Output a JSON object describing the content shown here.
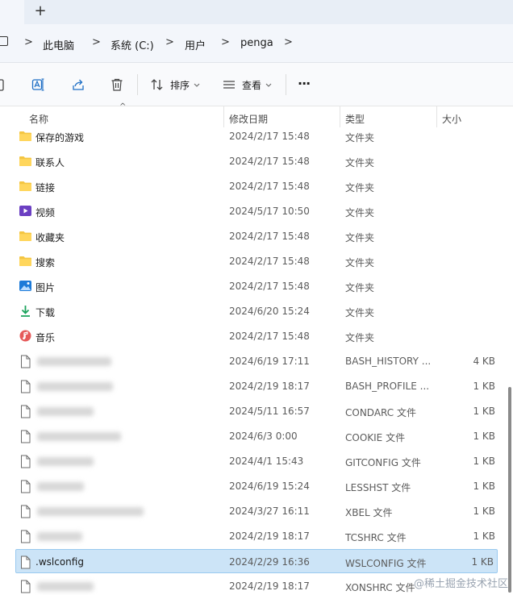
{
  "tabbar": {
    "new_tab": "+"
  },
  "breadcrumb": [
    "此电脑",
    "系统 (C:)",
    "用户",
    "penga"
  ],
  "chevron": ">",
  "commandbar": {
    "sort_label": "排序",
    "view_label": "查看",
    "more_label": "···"
  },
  "columns": {
    "name": "名称",
    "date": "修改日期",
    "type": "类型",
    "size": "大小"
  },
  "rows": [
    {
      "icon": "folder",
      "name": "保存的游戏",
      "date": "2024/2/17 15:48",
      "type": "文件夹",
      "size": ""
    },
    {
      "icon": "contacts-folder",
      "name": "联系人",
      "date": "2024/2/17 15:48",
      "type": "文件夹",
      "size": ""
    },
    {
      "icon": "folder",
      "name": "链接",
      "date": "2024/2/17 15:48",
      "type": "文件夹",
      "size": ""
    },
    {
      "icon": "video-folder",
      "name": "视频",
      "date": "2024/5/17 10:50",
      "type": "文件夹",
      "size": ""
    },
    {
      "icon": "folder",
      "name": "收藏夹",
      "date": "2024/2/17 15:48",
      "type": "文件夹",
      "size": ""
    },
    {
      "icon": "folder",
      "name": "搜索",
      "date": "2024/2/17 15:48",
      "type": "文件夹",
      "size": ""
    },
    {
      "icon": "pictures-folder",
      "name": "图片",
      "date": "2024/2/17 15:48",
      "type": "文件夹",
      "size": ""
    },
    {
      "icon": "download-folder",
      "name": "下载",
      "date": "2024/6/20 15:24",
      "type": "文件夹",
      "size": ""
    },
    {
      "icon": "music-folder",
      "name": "音乐",
      "date": "2024/2/17 15:48",
      "type": "文件夹",
      "size": ""
    },
    {
      "icon": "file",
      "name": "",
      "date": "2024/6/19 17:11",
      "type": "BASH_HISTORY ...",
      "size": "4 KB"
    },
    {
      "icon": "file",
      "name": "",
      "date": "2024/2/19 18:17",
      "type": "BASH_PROFILE ...",
      "size": "1 KB"
    },
    {
      "icon": "file",
      "name": "",
      "date": "2024/5/11 16:57",
      "type": "CONDARC 文件",
      "size": "1 KB"
    },
    {
      "icon": "file",
      "name": "",
      "date": "2024/6/3 0:00",
      "type": "COOKIE 文件",
      "size": "1 KB"
    },
    {
      "icon": "file",
      "name": "",
      "date": "2024/4/1 15:43",
      "type": "GITCONFIG 文件",
      "size": "1 KB"
    },
    {
      "icon": "file",
      "name": "",
      "date": "2024/6/19 15:24",
      "type": "LESSHST 文件",
      "size": "1 KB"
    },
    {
      "icon": "file",
      "name": "",
      "date": "2024/3/27 16:11",
      "type": "XBEL 文件",
      "size": "1 KB"
    },
    {
      "icon": "file",
      "name": "",
      "date": "2024/2/19 18:17",
      "type": "TCSHRC 文件",
      "size": "1 KB"
    },
    {
      "icon": "file",
      "name": ".wslconfig",
      "date": "2024/2/29 16:36",
      "type": "WSLCONFIG 文件",
      "size": "1 KB",
      "selected": true
    },
    {
      "icon": "file",
      "name": "",
      "date": "2024/2/19 18:17",
      "type": "XONSHRC 文件",
      "size": ""
    }
  ],
  "watermark": "@稀土掘金技术社区",
  "colors": {
    "folder": "#f4c542",
    "selected_bg": "#cce4f7",
    "accent": "#0067c0"
  }
}
